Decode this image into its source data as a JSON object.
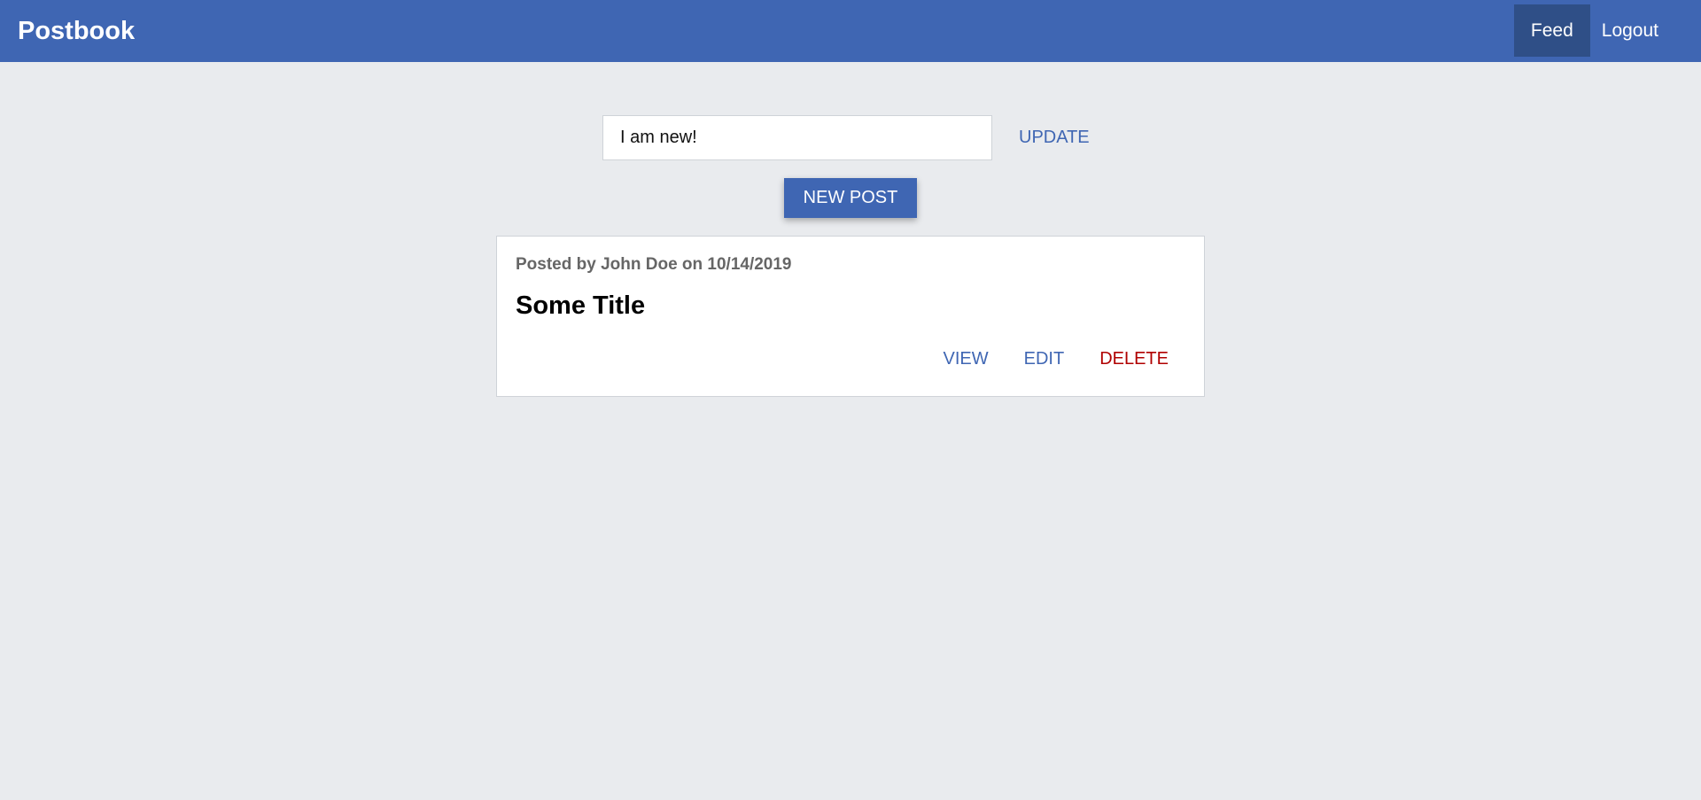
{
  "header": {
    "logo": "Postbook",
    "nav": {
      "feed": "Feed",
      "logout": "Logout"
    }
  },
  "editor": {
    "input_value": "I am new!",
    "update_label": "UPDATE",
    "new_post_label": "NEW POST"
  },
  "post": {
    "meta": "Posted by John Doe on 10/14/2019",
    "title": "Some Title",
    "actions": {
      "view": "VIEW",
      "edit": "EDIT",
      "delete": "DELETE"
    }
  },
  "colors": {
    "brand": "#3f66b3",
    "nav_active": "#2f4f87",
    "background": "#e9ebee",
    "danger": "#b00000"
  }
}
